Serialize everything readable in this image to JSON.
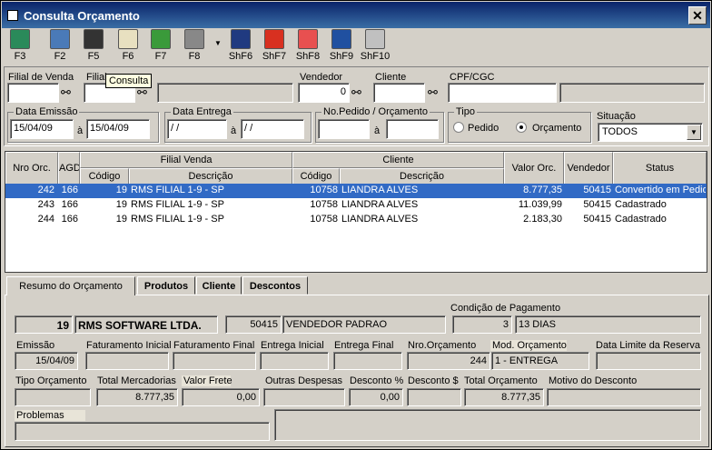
{
  "window": {
    "title": "Consulta Orçamento",
    "close": "✕"
  },
  "toolbar": [
    {
      "key": "F3",
      "icon": "exit-door-icon"
    },
    {
      "key": "F2",
      "icon": "print-preview-icon"
    },
    {
      "key": "F5",
      "icon": "printer-icon"
    },
    {
      "key": "F6",
      "icon": "copy-icon"
    },
    {
      "key": "F7",
      "icon": "spreadsheet-icon"
    },
    {
      "key": "F8",
      "icon": "print-icon"
    },
    {
      "key": "ShF6",
      "icon": "save-disk-icon"
    },
    {
      "key": "ShF7",
      "icon": "truck-icon"
    },
    {
      "key": "ShF8",
      "icon": "cancel-check-icon"
    },
    {
      "key": "ShF9",
      "icon": "computer-icon"
    },
    {
      "key": "ShF10",
      "icon": "lock-icon"
    }
  ],
  "tooltip": "Consulta",
  "filters": {
    "filial_venda_label": "Filial de Venda",
    "filial_label": "Filial",
    "vendedor_label": "Vendedor",
    "vendedor_value": "0",
    "cliente_label": "Cliente",
    "cpf_label": "CPF/CGC",
    "data_emissao_label": "Data Emissão",
    "emissao_de": "15/04/09",
    "a1": "à",
    "emissao_ate": "15/04/09",
    "data_entrega_label": "Data Entrega",
    "entrega_de": " / /",
    "a2": "à",
    "entrega_ate": " / /",
    "pedido_label": "No.Pedido / Orçamento",
    "a3": "à",
    "tipo_label": "Tipo",
    "tipo_pedido": "Pedido",
    "tipo_orcamento": "Orçamento",
    "situacao_label": "Situação",
    "situacao_value": "TODOS"
  },
  "grid": {
    "headers": {
      "nro": "Nro Orc.",
      "agd": "AGD",
      "filial_venda": "Filial Venda",
      "codigo": "Código",
      "descricao": "Descrição",
      "cliente": "Cliente",
      "codigo2": "Código",
      "descricao2": "Descrição",
      "valor": "Valor Orc.",
      "vendedor": "Vendedor",
      "status": "Status"
    },
    "rows": [
      {
        "nro": "242",
        "agd": "166",
        "fcod": "19",
        "fdesc": "RMS FILIAL 1-9 - SP",
        "ccod": "10758",
        "cdesc": "LIANDRA ALVES",
        "valor": "8.777,35",
        "vend": "50415",
        "status": "Convertido em Pedido"
      },
      {
        "nro": "243",
        "agd": "166",
        "fcod": "19",
        "fdesc": "RMS FILIAL 1-9 - SP",
        "ccod": "10758",
        "cdesc": "LIANDRA ALVES",
        "valor": "11.039,99",
        "vend": "50415",
        "status": "Cadastrado"
      },
      {
        "nro": "244",
        "agd": "166",
        "fcod": "19",
        "fdesc": "RMS FILIAL 1-9 - SP",
        "ccod": "10758",
        "cdesc": "LIANDRA ALVES",
        "valor": "2.183,30",
        "vend": "50415",
        "status": "Cadastrado"
      }
    ]
  },
  "tabs": [
    "Resumo do Orçamento",
    "Produtos",
    "Cliente",
    "Descontos"
  ],
  "resumo": {
    "filial_cod": "19",
    "filial_nome": "RMS SOFTWARE LTDA.",
    "vend_cod": "50415",
    "vend_nome": "VENDEDOR PADRAO",
    "cond_label": "Condição de Pagamento",
    "cond_cod": "3",
    "cond_desc": "13 DIAS",
    "emissao_label": "Emissão",
    "emissao": "15/04/09",
    "fat_ini_label": "Faturamento Inicial",
    "fat_fim_label": "Faturamento Final",
    "ent_ini_label": "Entrega Inicial",
    "ent_fim_label": "Entrega Final",
    "nro_orc_label": "Nro.Orçamento",
    "nro_orc": "244",
    "mod_label": "Mod. Orçamento",
    "mod": "1 - ENTREGA",
    "limite_label": "Data Limite da Reserva",
    "tipo_label": "Tipo Orçamento",
    "total_merc_label": "Total Mercadorias",
    "total_merc": "8.777,35",
    "frete_label": "Valor Frete",
    "frete": "0,00",
    "outras_label": "Outras Despesas",
    "desc_pct_label": "Desconto %",
    "desc_pct": "0,00",
    "desc_val_label": "Desconto $",
    "total_orc_label": "Total Orçamento",
    "total_orc": "8.777,35",
    "motivo_label": "Motivo do Desconto",
    "problemas_label": "Problemas"
  },
  "colors": {
    "title_start": "#0a246a",
    "title_end": "#3a6ea5",
    "selection": "#316ac5"
  }
}
